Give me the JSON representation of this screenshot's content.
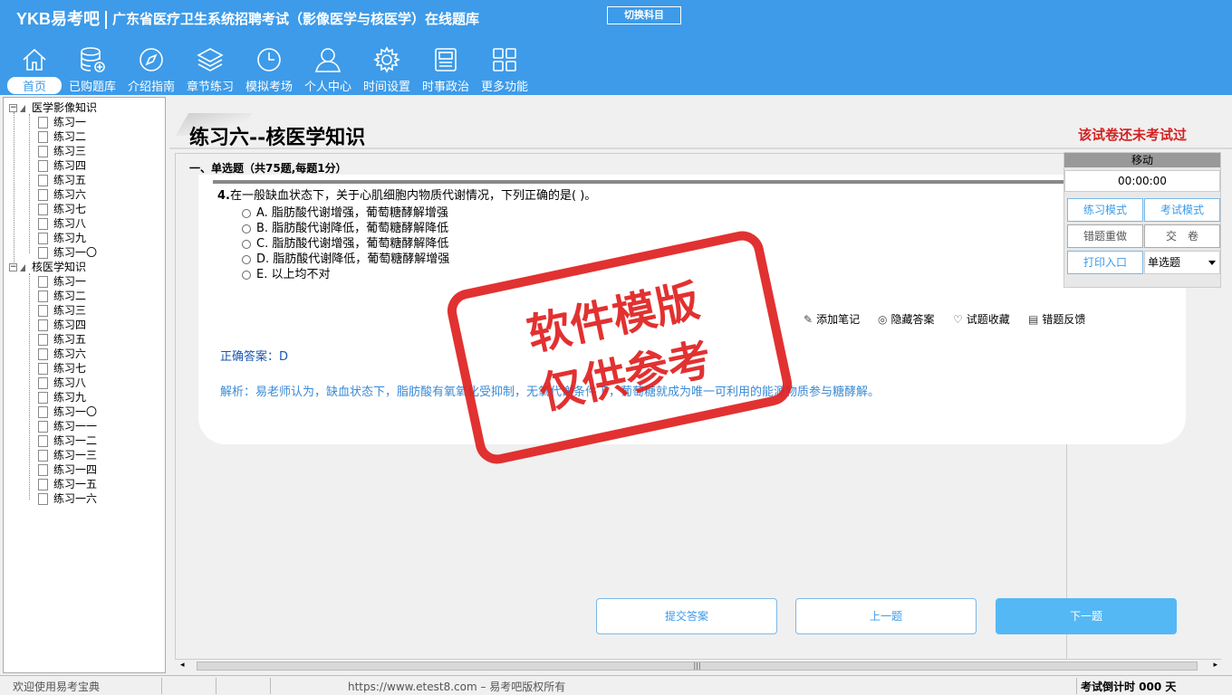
{
  "header": {
    "logo": "YKB易考吧",
    "title": "广东省医疗卫生系统招聘考试（影像医学与核医学）在线题库",
    "switch_label": "切换科目"
  },
  "nav": [
    {
      "label": "首页",
      "icon": "home-icon"
    },
    {
      "label": "已购题库",
      "icon": "database-icon"
    },
    {
      "label": "介绍指南",
      "icon": "compass-icon"
    },
    {
      "label": "章节练习",
      "icon": "layers-icon"
    },
    {
      "label": "模拟考场",
      "icon": "clock-icon"
    },
    {
      "label": "个人中心",
      "icon": "user-icon"
    },
    {
      "label": "时间设置",
      "icon": "gear-icon"
    },
    {
      "label": "时事政治",
      "icon": "news-icon"
    },
    {
      "label": "更多功能",
      "icon": "grid-icon"
    }
  ],
  "tree": {
    "group1": {
      "label": "医学影像知识",
      "items": [
        "练习一",
        "练习二",
        "练习三",
        "练习四",
        "练习五",
        "练习六",
        "练习七",
        "练习八",
        "练习九",
        "练习一〇"
      ]
    },
    "group2": {
      "label": "核医学知识",
      "items": [
        "练习一",
        "练习二",
        "练习三",
        "练习四",
        "练习五",
        "练习六",
        "练习七",
        "练习八",
        "练习九",
        "练习一〇",
        "练习一一",
        "练习一二",
        "练习一三",
        "练习一四",
        "练习一五",
        "练习一六"
      ]
    }
  },
  "paper": {
    "title": "练习六--核医学知识",
    "status": "该试卷还未考试过",
    "section": "一、单选题（共75题,每题1分）"
  },
  "question": {
    "number": "4.",
    "text": "在一般缺血状态下，关于心肌细胞内物质代谢情况，下列正确的是( )。",
    "options": [
      "A. 脂肪酸代谢增强，葡萄糖酵解增强",
      "B. 脂肪酸代谢降低，葡萄糖酵解降低",
      "C. 脂肪酸代谢增强，葡萄糖酵解降低",
      "D. 脂肪酸代谢降低，葡萄糖酵解增强",
      "E. 以上均不对"
    ],
    "answer": "正确答案：D",
    "analysis": "解析：易老师认为，缺血状态下，脂肪酸有氧氧化受抑制，无氧代谢条件下，葡萄糖就成为唯一可利用的能源物质参与糖酵解。"
  },
  "tools": {
    "add_note": "添加笔记",
    "hide_answer": "隐藏答案",
    "favorite": "试题收藏",
    "feedback": "错题反馈"
  },
  "buttons": {
    "submit": "提交答案",
    "prev": "上一题",
    "next": "下一题"
  },
  "panel": {
    "move": "移动",
    "timer": "00:00:00",
    "practice_mode": "练习模式",
    "exam_mode": "考试模式",
    "redo_wrong": "错题重做",
    "hand_in": "交　卷",
    "print": "打印入口",
    "qtype": "单选题"
  },
  "footer": {
    "welcome": "欢迎使用易考宝典",
    "copyright": "https://www.etest8.com – 易考吧版权所有",
    "countdown": "考试倒计时 000 天"
  },
  "watermark": {
    "line1": "软件模版",
    "line2": "仅供参考"
  },
  "colors": {
    "header": "#3d9be9",
    "status": "#d42020",
    "answer": "#1a55b0",
    "analysis": "#3a8ad6",
    "stamp": "#e02020"
  }
}
